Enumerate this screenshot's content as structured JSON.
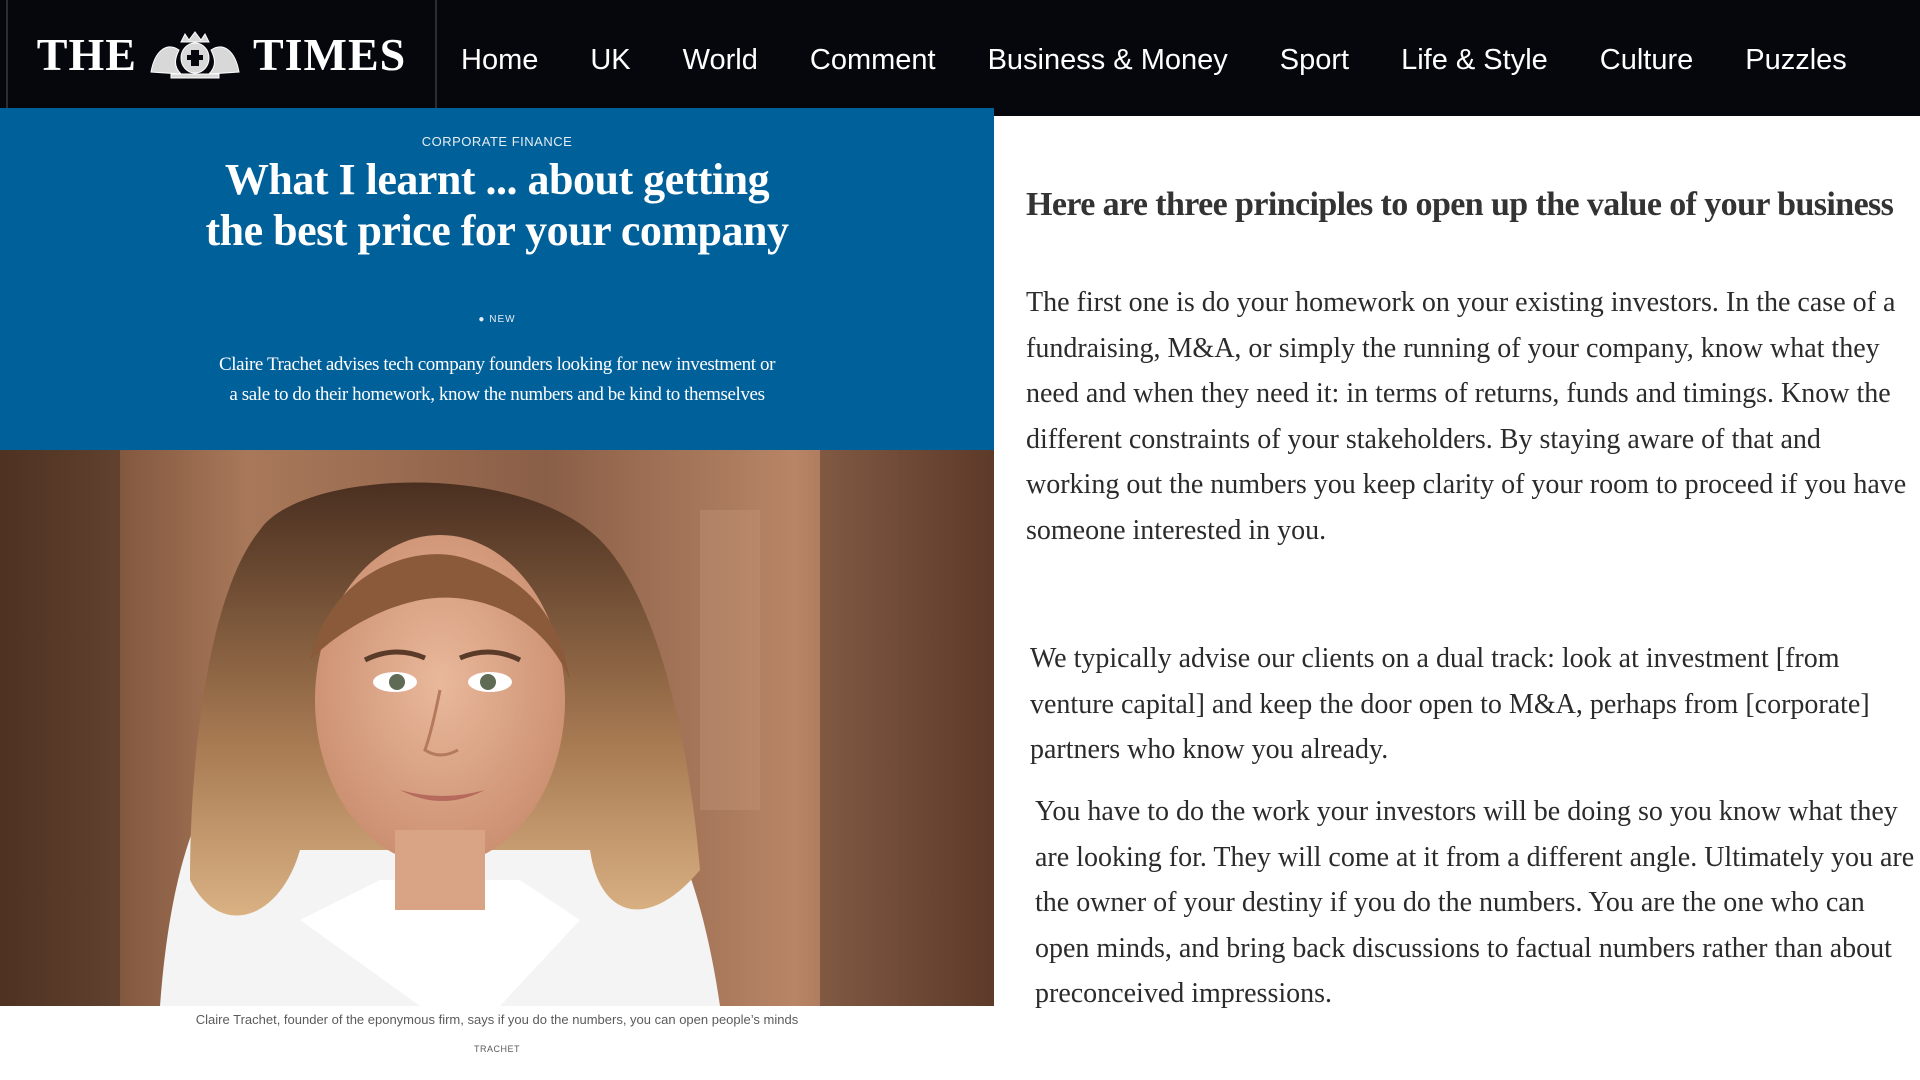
{
  "header": {
    "logo_left": "THE",
    "logo_right": "TIMES",
    "nav": [
      "Home",
      "UK",
      "World",
      "Comment",
      "Business & Money",
      "Sport",
      "Life & Style",
      "Culture",
      "Puzzles"
    ]
  },
  "article": {
    "kicker": "CORPORATE FINANCE",
    "headline": "What I learnt ... about getting the best price for your company",
    "badge": "NEW",
    "standfirst": "Claire Trachet advises tech company founders looking for new investment or a sale to do their homework, know the numbers and be kind to themselves",
    "caption": "Claire Trachet, founder of the eponymous firm, says if you do the numbers, you can open people’s minds",
    "credit": "TRACHET"
  },
  "body": {
    "subhead": "Here are three principles to open up the value of your business",
    "paragraphs": [
      "The first one is do your homework on your existing investors. In the case of a fundraising, M&A, or simply the running of your company, know what they need and when they need it: in terms of returns, funds and timings. Know the different constraints of your stakeholders. By staying aware of that and working out the numbers you keep clarity of your room to proceed if you have someone interested in you.",
      "We typically advise our clients on a dual track: look at investment [from venture capital] and keep the door open to M&A, perhaps from [corporate] partners who know you already.",
      "You have to do the work your investors will be doing so you know what they are looking for. They will come at it from a different angle. Ultimately you are the owner of your destiny if you do the numbers. You are the one who can open minds, and bring back discussions to factual numbers rather than about preconceived impressions."
    ]
  },
  "colors": {
    "topbar": "#06060d",
    "hero_blue": "#00609a",
    "body_text": "#2b2b2b"
  }
}
